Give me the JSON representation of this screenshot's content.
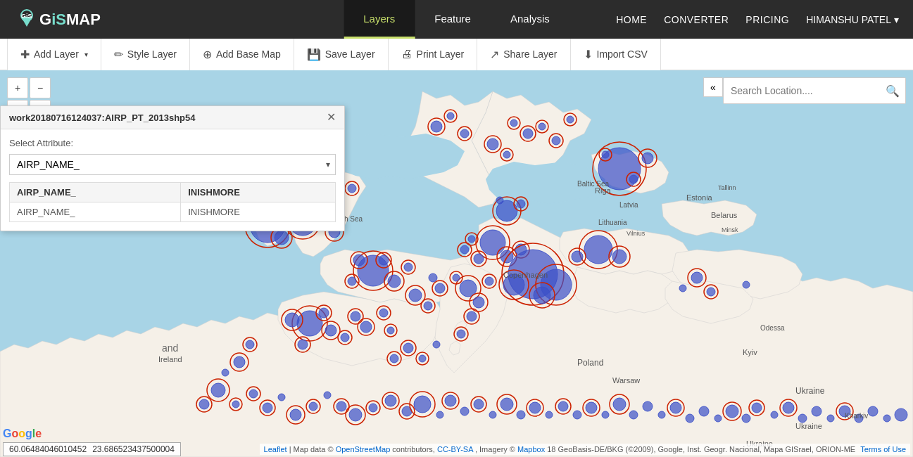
{
  "app": {
    "logo": "GiS MAP",
    "logo_icon": "🌍"
  },
  "nav": {
    "home": "HOME",
    "converter": "CONVERTER",
    "pricing": "PRICING",
    "user": "HIMANSHU PATEL",
    "user_dropdown": "▾"
  },
  "center_tabs": [
    {
      "id": "layers",
      "label": "Layers",
      "active": true
    },
    {
      "id": "feature",
      "label": "Feature",
      "active": false
    },
    {
      "id": "analysis",
      "label": "Analysis",
      "active": false
    }
  ],
  "toolbar": {
    "add_layer": "Add Layer",
    "style_layer": "Style Layer",
    "add_base_map": "Add Base Map",
    "save_layer": "Save Layer",
    "print_layer": "Print Layer",
    "share_layer": "Share Layer",
    "import_csv": "Import CSV"
  },
  "map_controls": {
    "zoom_in": "+",
    "zoom_out": "−",
    "refresh": "↺",
    "settings": "⚙",
    "print": "🖨",
    "expand": "»"
  },
  "search": {
    "placeholder": "Search Location....",
    "icon": "🔍"
  },
  "popup": {
    "title": "work20180716124037:AIRP_PT_2013shp54",
    "label": "Select Attribute:",
    "selected_attribute": "AIRP_NAME_",
    "table_headers": [
      "AIRP_NAME_",
      "INISHMORE"
    ],
    "table_rows": [
      [
        "AIRP_NAME_",
        "INISHMORE"
      ]
    ],
    "options": [
      "AIRP_NAME_"
    ]
  },
  "coords": {
    "lat": "60.06484046010452",
    "lng": "23.686523437500004"
  },
  "attribution": {
    "leaflet": "Leaflet",
    "map_data": "Map data ©",
    "osm": "OpenStreetMap",
    "contributors": "contributors,",
    "cc": "CC-BY-SA",
    "imagery": ", Imagery ©",
    "mapbox": "Mapbox",
    "geo": "18 GeoBasis-DE/BKG (©2009), Google, Inst. Geogr. Nacional, Mapa GISrael, ORION-ME",
    "terms": "Terms of Use"
  }
}
